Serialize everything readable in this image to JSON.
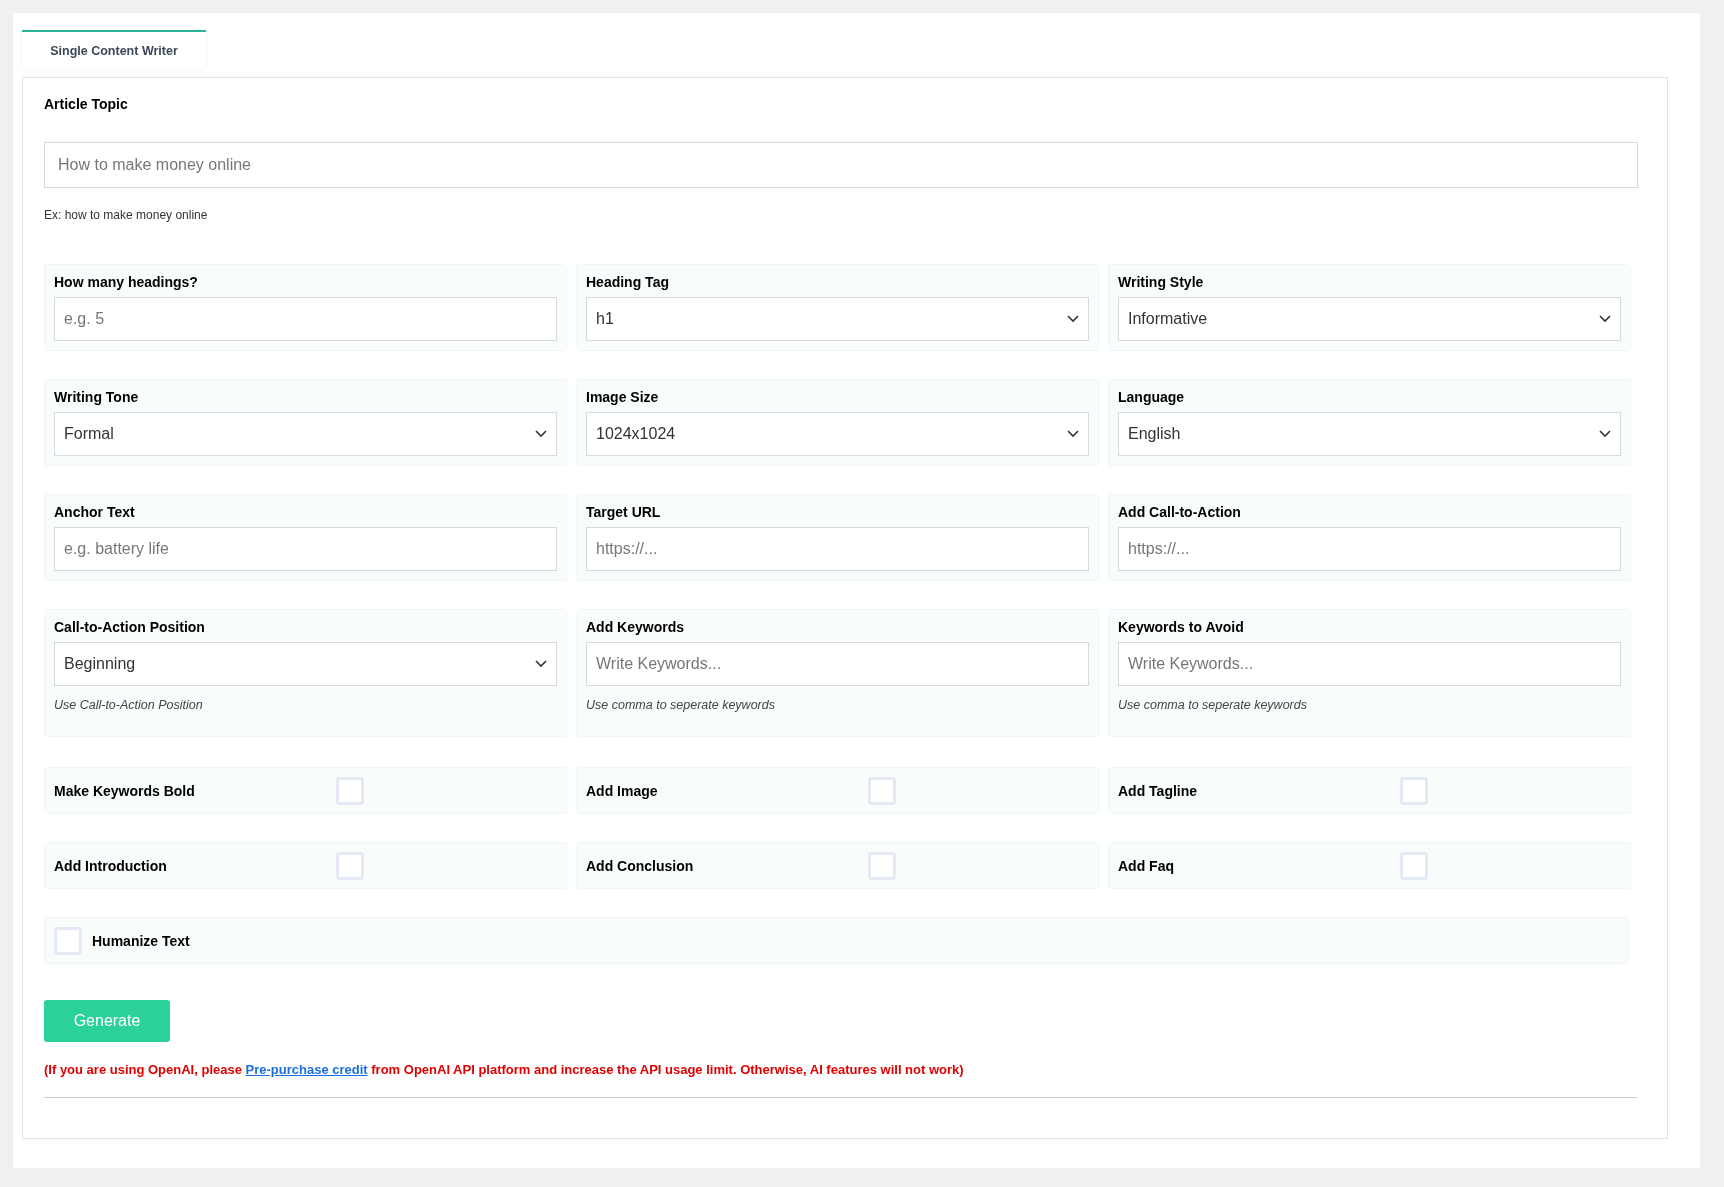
{
  "tabs": [
    {
      "label": "Single Content Writer",
      "selected": true
    }
  ],
  "topic": {
    "label": "Article Topic",
    "placeholder": "How to make money online",
    "hint": "Ex: how to make money online"
  },
  "fields": [
    {
      "kind": "text",
      "label": "How many headings?",
      "placeholder": "e.g. 5"
    },
    {
      "kind": "select",
      "label": "Heading Tag",
      "value": "h1"
    },
    {
      "kind": "select",
      "label": "Writing Style",
      "value": "Informative"
    },
    {
      "kind": "select",
      "label": "Writing Tone",
      "value": "Formal"
    },
    {
      "kind": "select",
      "label": "Image Size",
      "value": "1024x1024"
    },
    {
      "kind": "select",
      "label": "Language",
      "value": "English"
    },
    {
      "kind": "text",
      "label": "Anchor Text",
      "placeholder": "e.g. battery life"
    },
    {
      "kind": "text",
      "label": "Target URL",
      "placeholder": "https://..."
    },
    {
      "kind": "text",
      "label": "Add Call-to-Action",
      "placeholder": "https://..."
    },
    {
      "kind": "select",
      "label": "Call-to-Action Position",
      "value": "Beginning",
      "note": "Use Call-to-Action Position"
    },
    {
      "kind": "text",
      "label": "Add Keywords",
      "placeholder": "Write Keywords...",
      "note": "Use comma to seperate keywords"
    },
    {
      "kind": "text",
      "label": "Keywords to Avoid",
      "placeholder": "Write Keywords...",
      "note": "Use comma to seperate keywords"
    }
  ],
  "options": [
    {
      "label": "Make Keywords Bold",
      "checked": false
    },
    {
      "label": "Add Image",
      "checked": false
    },
    {
      "label": "Add Tagline",
      "checked": false
    },
    {
      "label": "Add Introduction",
      "checked": false
    },
    {
      "label": "Add Conclusion",
      "checked": false
    },
    {
      "label": "Add Faq",
      "checked": false
    }
  ],
  "humanize": {
    "label": "Humanize Text",
    "checked": false
  },
  "generate_button": "Generate",
  "notice": "(If you are using OpenAI, please ",
  "notice_link": "Pre-purchase credit",
  "notice_end": " from OpenAI API platform and increase the API usage limit. Otherwise, AI features will not work)"
}
